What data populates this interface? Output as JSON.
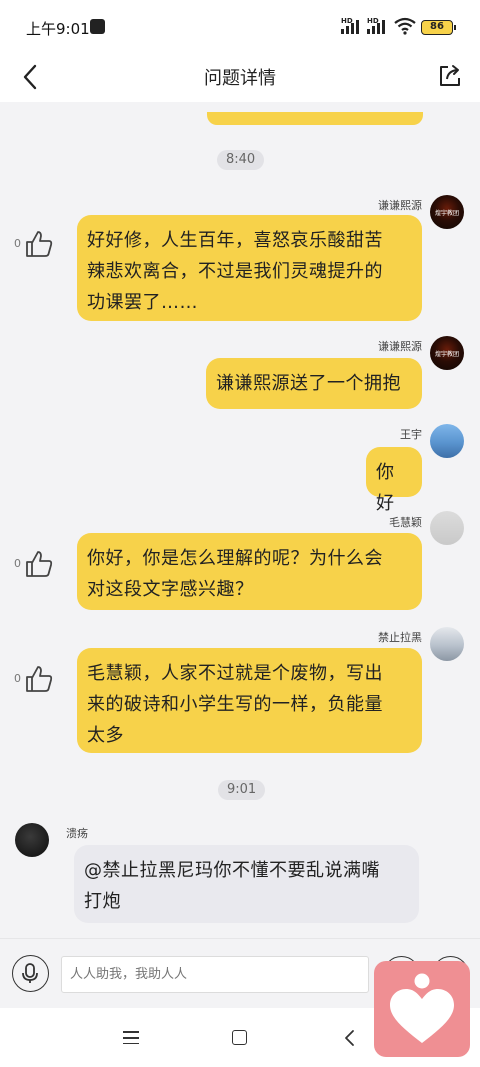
{
  "status_bar": {
    "time": "上午9:01",
    "net1": "HD",
    "net2": "HD",
    "battery": "86"
  },
  "header": {
    "title": "问题详情"
  },
  "timestamps": [
    "8:40",
    "9:01"
  ],
  "messages": [
    {
      "sender": "谦谦熙源",
      "avatar_text": "煌宇教团",
      "text_lines": [
        "好好修，人生百年，喜怒哀乐酸甜苦",
        "辣悲欢离合，不过是我们灵魂提升的",
        "功课罢了……"
      ],
      "likes": "0"
    },
    {
      "sender": "谦谦熙源",
      "avatar_text": "煌宇教团",
      "text_lines": [
        "谦谦熙源送了一个拥抱"
      ]
    },
    {
      "sender": "王宇",
      "text_lines": [
        "你好"
      ]
    },
    {
      "sender": "毛慧颖",
      "text_lines": [
        "你好，你是怎么理解的呢？为什么会",
        "对这段文字感兴趣？"
      ],
      "likes": "0"
    },
    {
      "sender": "禁止拉黑",
      "text_lines": [
        "毛慧颖，人家不过就是个废物，写出",
        "来的破诗和小学生写的一样，负能量",
        "太多"
      ],
      "likes": "0"
    },
    {
      "sender": "溃疡",
      "text_lines": [
        "@禁止拉黑尼玛你不懂不要乱说满嘴",
        "打炮"
      ]
    }
  ],
  "input": {
    "placeholder": "人人助我，我助人人"
  },
  "icons": {
    "back": "chevron-left-icon",
    "share": "share-icon",
    "like": "thumbs-up-icon",
    "mic": "microphone-icon",
    "float_app": "heart-person-icon"
  },
  "colors": {
    "bubble_self": "#f7d24a",
    "bubble_other": "#e9e9ee",
    "chat_bg": "#f3f3f5",
    "float_app": "#ef8f93"
  }
}
